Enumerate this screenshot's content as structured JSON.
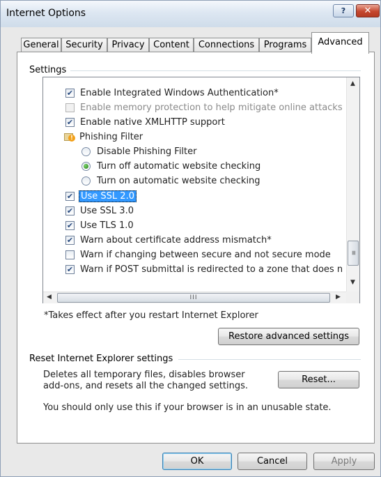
{
  "window": {
    "title": "Internet Options"
  },
  "titlebar": {
    "help_glyph": "?",
    "close_glyph": "✕"
  },
  "tabs": [
    {
      "label": "General"
    },
    {
      "label": "Security"
    },
    {
      "label": "Privacy"
    },
    {
      "label": "Content"
    },
    {
      "label": "Connections"
    },
    {
      "label": "Programs"
    },
    {
      "label": "Advanced",
      "active": true
    }
  ],
  "settings": {
    "group_label": "Settings",
    "items": [
      {
        "type": "checkbox",
        "label": "Enable Integrated Windows Authentication*",
        "checked": true,
        "enabled": true
      },
      {
        "type": "checkbox",
        "label": "Enable memory protection to help mitigate online attacks",
        "checked": false,
        "enabled": false
      },
      {
        "type": "checkbox",
        "label": "Enable native XMLHTTP support",
        "checked": true,
        "enabled": true
      },
      {
        "type": "folder",
        "label": "Phishing Filter",
        "icon": "phishing-filter-icon"
      },
      {
        "type": "radio",
        "label": "Disable Phishing Filter",
        "selected": false
      },
      {
        "type": "radio",
        "label": "Turn off automatic website checking",
        "selected": true
      },
      {
        "type": "radio",
        "label": "Turn on automatic website checking",
        "selected": false
      },
      {
        "type": "checkbox",
        "label": "Use SSL 2.0",
        "checked": true,
        "enabled": true,
        "focused": true
      },
      {
        "type": "checkbox",
        "label": "Use SSL 3.0",
        "checked": true,
        "enabled": true
      },
      {
        "type": "checkbox",
        "label": "Use TLS 1.0",
        "checked": true,
        "enabled": true
      },
      {
        "type": "checkbox",
        "label": "Warn about certificate address mismatch*",
        "checked": true,
        "enabled": true
      },
      {
        "type": "checkbox",
        "label": "Warn if changing between secure and not secure mode",
        "checked": false,
        "enabled": true
      },
      {
        "type": "checkbox",
        "label": "Warn if POST submittal is redirected to a zone that does n",
        "checked": true,
        "enabled": true
      }
    ],
    "footnote": "*Takes effect after you restart Internet Explorer",
    "restore_button": "Restore advanced settings"
  },
  "reset": {
    "group_label": "Reset Internet Explorer settings",
    "description_line1": "Deletes all temporary files, disables browser",
    "description_line2": "add-ons, and resets all the changed settings.",
    "button": "Reset...",
    "warning": "You should only use this if your browser is in an unusable state."
  },
  "footer": {
    "ok": "OK",
    "cancel": "Cancel",
    "apply": "Apply"
  },
  "scrollbar": {
    "grip": "III",
    "up": "▲",
    "down": "▼",
    "left": "◀",
    "right": "▶"
  },
  "colors": {
    "accent": "#3399ff",
    "title_bar": "#dde7f2",
    "close": "#c5482f"
  }
}
